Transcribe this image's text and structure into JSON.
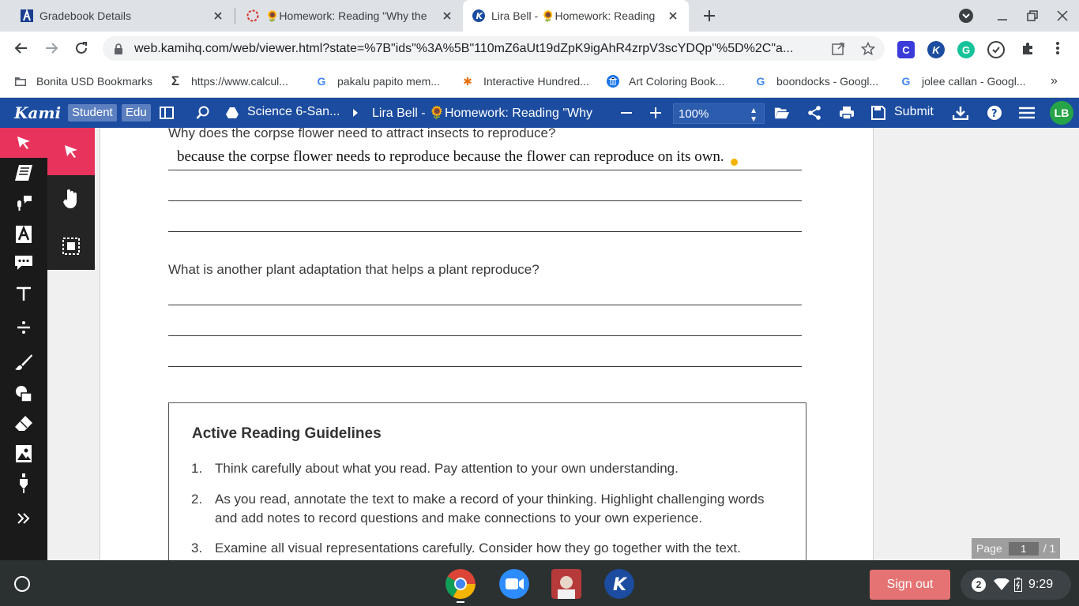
{
  "browser": {
    "tabs": [
      {
        "title": "Gradebook Details",
        "active": false
      },
      {
        "title": "🌻Homework: Reading \"Why the",
        "active": false
      },
      {
        "title": "Lira Bell - 🌻Homework: Reading",
        "active": true
      }
    ],
    "url": "web.kamihq.com/web/viewer.html?state=%7B\"ids\"%3A%5B\"110mZ6aUt19dZpK9igAhR4zrpV3scYDQp\"%5D%2C\"a...",
    "bookmarks": [
      {
        "label": "Bonita USD Bookmarks",
        "icon": "folder-icon"
      },
      {
        "label": "https://www.calcul...",
        "icon": "sigma-icon"
      },
      {
        "label": "pakalu papito mem...",
        "icon": "google-icon"
      },
      {
        "label": "Interactive Hundred...",
        "icon": "party-icon"
      },
      {
        "label": "Art Coloring Book...",
        "icon": "museum-icon"
      },
      {
        "label": "boondocks - Googl...",
        "icon": "google-icon"
      },
      {
        "label": "jolee callan - Googl...",
        "icon": "google-icon"
      }
    ],
    "extensions": [
      {
        "letter": "C",
        "color": "#3b3bd9"
      },
      {
        "letter": "K",
        "color": "#1b4c9f"
      },
      {
        "letter": "G",
        "color": "#15c39a"
      },
      {
        "letter": "",
        "color": "#3c4043"
      }
    ]
  },
  "kami": {
    "logo": "Kami",
    "role_student": "Student",
    "role_edu": "Edu",
    "breadcrumb_folder": "Science 6-San...",
    "breadcrumb_file": "Lira Bell - 🌻Homework: Reading \"Why",
    "zoom": "100%",
    "submit_label": "Submit",
    "avatar_initials": "LB",
    "colors": {
      "toolbar": "#1b4c9f",
      "accent": "#e8345d"
    }
  },
  "document": {
    "question1": "Why does the corpse flower need to attract insects to reproduce?",
    "answer1": "because the corpse flower needs to reproduce because the flower can reproduce on its own.",
    "question2": "What is another plant adaptation that helps a plant reproduce?",
    "guidelines_title": "Active Reading Guidelines",
    "guidelines": [
      {
        "num": "1.",
        "text": "Think carefully about what you read. Pay attention to your own understanding."
      },
      {
        "num": "2.",
        "text": "As you read, annotate the text to make a record of your thinking. Highlight challenging words and add notes to record questions and make connections to your own experience."
      },
      {
        "num": "3.",
        "text": "Examine all visual representations carefully. Consider how they go together with the text."
      }
    ]
  },
  "pager": {
    "label": "Page",
    "current": "1",
    "total": "/ 1"
  },
  "shelf": {
    "signout": "Sign out",
    "notifications": "2",
    "time": "9:29"
  }
}
